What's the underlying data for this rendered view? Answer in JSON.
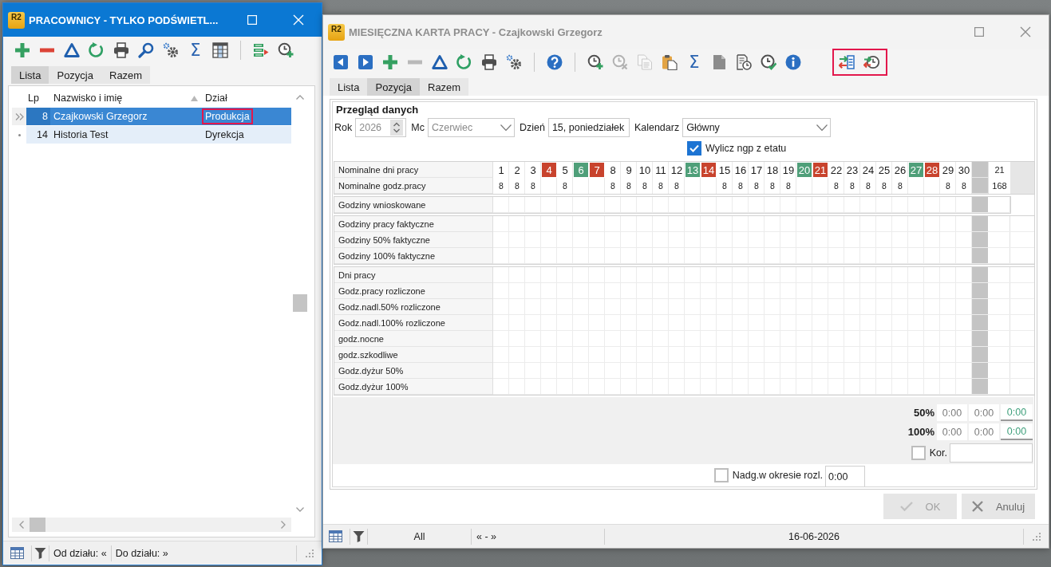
{
  "employees_window": {
    "logo": "R2",
    "title": "PRACOWNICY - TYLKO PODŚWIETL...",
    "active": true,
    "toolbar": [
      {
        "kind": "add",
        "disabled": false
      },
      {
        "kind": "remove",
        "disabled": false
      },
      {
        "kind": "delta",
        "disabled": false
      },
      {
        "kind": "refresh",
        "disabled": false
      },
      {
        "kind": "print",
        "disabled": false
      },
      {
        "kind": "search",
        "disabled": false
      },
      {
        "kind": "settings",
        "disabled": false
      },
      {
        "kind": "sum",
        "label": "Σ",
        "disabled": false
      },
      {
        "kind": "columns",
        "disabled": false
      },
      {
        "kind": "separator"
      },
      {
        "kind": "schedule",
        "disabled": false
      },
      {
        "kind": "clockadd",
        "disabled": false
      }
    ],
    "tabs": [
      {
        "label": "Lista",
        "selected": true
      },
      {
        "label": "Pozycja",
        "selected": false
      },
      {
        "label": "Razem",
        "selected": false
      }
    ],
    "table": {
      "columns": [
        {
          "label": "Lp",
          "sorted": false
        },
        {
          "label": "Nazwisko i imię",
          "sorted": true
        },
        {
          "label": "Dział",
          "sorted": false
        }
      ],
      "rows": [
        {
          "lp": "8",
          "name": "Czajkowski Grzegorz",
          "department": "Produkcja",
          "selected": true,
          "highlighted": true
        },
        {
          "lp": "14",
          "name": "Historia Test",
          "department": "Dyrekcja",
          "selected": false,
          "highlighted": false
        }
      ]
    },
    "status_bar": [
      "Od działu: «",
      "Do działu: »"
    ]
  },
  "timesheet_window": {
    "logo": "R2",
    "title": "MIESIĘCZNA KARTA PRACY - Czajkowski Grzegorz",
    "active": false,
    "toolbar": [
      {
        "kind": "previous",
        "disabled": false,
        "highlighted": false
      },
      {
        "kind": "next",
        "disabled": false,
        "highlighted": false
      },
      {
        "kind": "add",
        "disabled": false,
        "highlighted": false
      },
      {
        "kind": "remove",
        "disabled": true,
        "highlighted": false
      },
      {
        "kind": "delta",
        "disabled": false,
        "highlighted": false
      },
      {
        "kind": "refresh",
        "disabled": false,
        "highlighted": false
      },
      {
        "kind": "print",
        "disabled": false,
        "highlighted": false
      },
      {
        "kind": "settings",
        "disabled": false,
        "highlighted": false
      },
      {
        "kind": "separator"
      },
      {
        "kind": "help",
        "disabled": false,
        "highlighted": false
      },
      {
        "kind": "separator"
      },
      {
        "kind": "clockadd",
        "disabled": false,
        "highlighted": false
      },
      {
        "kind": "clockremove",
        "disabled": true,
        "highlighted": false
      },
      {
        "kind": "copy",
        "disabled": true,
        "highlighted": false
      },
      {
        "kind": "paste",
        "disabled": false,
        "highlighted": false
      },
      {
        "kind": "sum",
        "label": "Σ",
        "disabled": false,
        "highlighted": false
      },
      {
        "kind": "page",
        "disabled": false,
        "highlighted": false
      },
      {
        "kind": "report",
        "disabled": false,
        "highlighted": false
      },
      {
        "kind": "approve",
        "disabled": false,
        "highlighted": false
      },
      {
        "kind": "info",
        "disabled": false,
        "highlighted": false
      },
      {
        "kind": "transferlist",
        "disabled": false,
        "highlighted": true
      },
      {
        "kind": "transferclock",
        "disabled": false,
        "highlighted": true
      }
    ],
    "tabs": [
      {
        "label": "Lista",
        "selected": false
      },
      {
        "label": "Pozycja",
        "selected": true
      },
      {
        "label": "Razem",
        "selected": false
      }
    ],
    "group_title": "Przegląd danych",
    "fields": [
      {
        "label": "Rok",
        "kind": "spinner",
        "value": "2026",
        "disabled": true
      },
      {
        "label": "Mc",
        "kind": "dropdown",
        "value": "Czerwiec",
        "disabled": true
      },
      {
        "label": "Dzień",
        "kind": "text",
        "value": "15, poniedziałek",
        "disabled": false
      },
      {
        "label": "Kalendarz",
        "kind": "dropdown",
        "value": "Główny",
        "disabled": false
      }
    ],
    "option": {
      "label": "Wylicz ngp z etatu",
      "checked": true
    },
    "grid": {
      "header_rows": [
        "Nominalne dni pracy",
        "Nominalne godz.pracy"
      ],
      "days": [
        {
          "day": "1",
          "hours": "8"
        },
        {
          "day": "2",
          "hours": "8"
        },
        {
          "day": "3",
          "hours": "8"
        },
        {
          "day": "4",
          "color": "#c8432d"
        },
        {
          "day": "5",
          "hours": "8"
        },
        {
          "day": "6",
          "color": "#4f9f79"
        },
        {
          "day": "7",
          "color": "#c8432d"
        },
        {
          "day": "8",
          "hours": "8"
        },
        {
          "day": "9",
          "hours": "8"
        },
        {
          "day": "10",
          "hours": "8"
        },
        {
          "day": "11",
          "hours": "8"
        },
        {
          "day": "12",
          "hours": "8"
        },
        {
          "day": "13",
          "color": "#4f9f79"
        },
        {
          "day": "14",
          "color": "#c8432d"
        },
        {
          "day": "15",
          "hours": "8"
        },
        {
          "day": "16",
          "hours": "8"
        },
        {
          "day": "17",
          "hours": "8"
        },
        {
          "day": "18",
          "hours": "8"
        },
        {
          "day": "19",
          "hours": "8"
        },
        {
          "day": "20",
          "color": "#4f9f79"
        },
        {
          "day": "21",
          "color": "#c8432d"
        },
        {
          "day": "22",
          "hours": "8"
        },
        {
          "day": "23",
          "hours": "8"
        },
        {
          "day": "24",
          "hours": "8"
        },
        {
          "day": "25",
          "hours": "8"
        },
        {
          "day": "26",
          "hours": "8"
        },
        {
          "day": "27",
          "color": "#4f9f79"
        },
        {
          "day": "28",
          "color": "#c8432d"
        },
        {
          "day": "29",
          "hours": "8"
        },
        {
          "day": "30",
          "hours": "8"
        }
      ],
      "total_days": "21",
      "total_hours": "168",
      "sections": [
        {
          "rows": [
            "Godziny wnioskowane"
          ]
        },
        {
          "rows": [
            "Godziny pracy faktyczne",
            "Godziny 50% faktyczne",
            "Godziny 100% faktyczne"
          ]
        },
        {
          "rows": [
            "Dni pracy",
            "Godz.pracy rozliczone",
            "Godz.nadl.50% rozliczone",
            "Godz.nadl.100% rozliczone",
            "godz.nocne",
            "godz.szkodliwe",
            "Godz.dyżur 50%",
            "Godz.dyżur 100%"
          ]
        }
      ]
    },
    "totals": [
      {
        "label": "50%",
        "values": [
          "0:00",
          "0:00",
          "0:00"
        ]
      },
      {
        "label": "100%",
        "values": [
          "0:00",
          "0:00",
          "0:00"
        ]
      }
    ],
    "correction": {
      "label": "Kor.",
      "checked": false
    },
    "overtime": {
      "label": "Nadg.w okresie rozl.",
      "checked": false,
      "value": "0:00"
    },
    "buttons": [
      {
        "kind": "ok",
        "label": "OK",
        "disabled": true
      },
      {
        "kind": "cancel",
        "label": "Anuluj",
        "disabled": false
      }
    ],
    "status_bar": [
      "All",
      "« - »",
      "16-06-2026"
    ]
  }
}
